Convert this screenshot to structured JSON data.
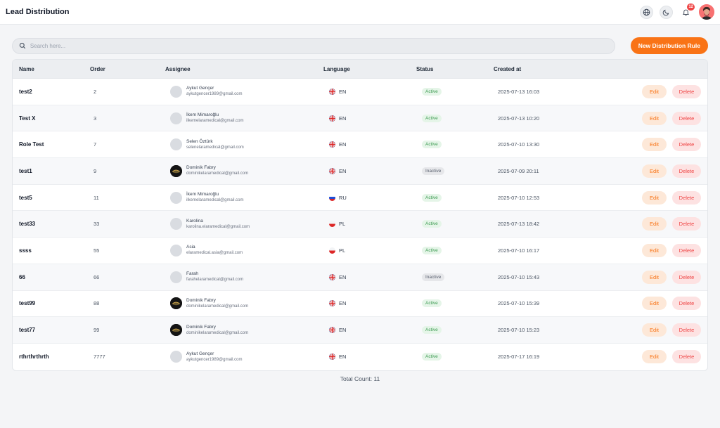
{
  "header": {
    "title": "Lead Distribution",
    "notification_count": "12"
  },
  "search": {
    "placeholder": "Search here...",
    "value": ""
  },
  "actions": {
    "new_rule_label": "New Distribution Rule"
  },
  "table": {
    "columns": {
      "name": "Name",
      "order": "Order",
      "assignee": "Assignee",
      "language": "Language",
      "status": "Status",
      "created_at": "Created at"
    },
    "edit_label": "Edit",
    "delete_label": "Delete",
    "rows": [
      {
        "name": "test2",
        "order": "2",
        "assignee_name": "Aykut Gençer",
        "assignee_email": "aykutgencer1989@gmail.com",
        "avatar": "placeholder",
        "language": "EN",
        "status": "Active",
        "created": "2025-07-13 16:03"
      },
      {
        "name": "Test X",
        "order": "3",
        "assignee_name": "İkem Mimaroğlu",
        "assignee_email": "ilkemelaramedical@gmail.com",
        "avatar": "placeholder",
        "language": "EN",
        "status": "Active",
        "created": "2025-07-13 10:20"
      },
      {
        "name": "Role Test",
        "order": "7",
        "assignee_name": "Selen Öztürk",
        "assignee_email": "selenelaramedical@gmail.com",
        "avatar": "placeholder",
        "language": "EN",
        "status": "Active",
        "created": "2025-07-10 13:30"
      },
      {
        "name": "test1",
        "order": "9",
        "assignee_name": "Dominik Fabry",
        "assignee_email": "dominikelaramedical@gmail.com",
        "avatar": "photo",
        "language": "EN",
        "status": "Inactive",
        "created": "2025-07-09 20:11"
      },
      {
        "name": "test5",
        "order": "11",
        "assignee_name": "İkem Mimaroğlu",
        "assignee_email": "ilkemelaramedical@gmail.com",
        "avatar": "placeholder",
        "language": "RU",
        "status": "Active",
        "created": "2025-07-10 12:53"
      },
      {
        "name": "test33",
        "order": "33",
        "assignee_name": "Karolina",
        "assignee_email": "karolina.elaramedical@gmail.com",
        "avatar": "placeholder",
        "language": "PL",
        "status": "Active",
        "created": "2025-07-13 18:42"
      },
      {
        "name": "ssss",
        "order": "55",
        "assignee_name": "Asia",
        "assignee_email": "elaramedical.asia@gmail.com",
        "avatar": "placeholder",
        "language": "PL",
        "status": "Active",
        "created": "2025-07-10 16:17"
      },
      {
        "name": "66",
        "order": "66",
        "assignee_name": "Farah",
        "assignee_email": "farahelaramedical@gmail.com",
        "avatar": "placeholder",
        "language": "EN",
        "status": "Inactive",
        "created": "2025-07-10 15:43"
      },
      {
        "name": "test99",
        "order": "88",
        "assignee_name": "Dominik Fabry",
        "assignee_email": "dominikelaramedical@gmail.com",
        "avatar": "photo",
        "language": "EN",
        "status": "Active",
        "created": "2025-07-10 15:39"
      },
      {
        "name": "test77",
        "order": "99",
        "assignee_name": "Dominik Fabry",
        "assignee_email": "dominikelaramedical@gmail.com",
        "avatar": "photo",
        "language": "EN",
        "status": "Active",
        "created": "2025-07-10 15:23"
      },
      {
        "name": "rthrthrthrth",
        "order": "7777",
        "assignee_name": "Aykut Gençer",
        "assignee_email": "aykutgencer1989@gmail.com",
        "avatar": "placeholder",
        "language": "EN",
        "status": "Active",
        "created": "2025-07-17 16:19"
      }
    ]
  },
  "footer": {
    "total_count": "Total Count: 11"
  },
  "colors": {
    "accent": "#f97316",
    "danger": "#ef4444",
    "active": "#3b9a50"
  },
  "icons": {
    "language": "globe-icon",
    "theme": "moon-icon",
    "notifications": "bell-icon",
    "search": "search-icon"
  }
}
